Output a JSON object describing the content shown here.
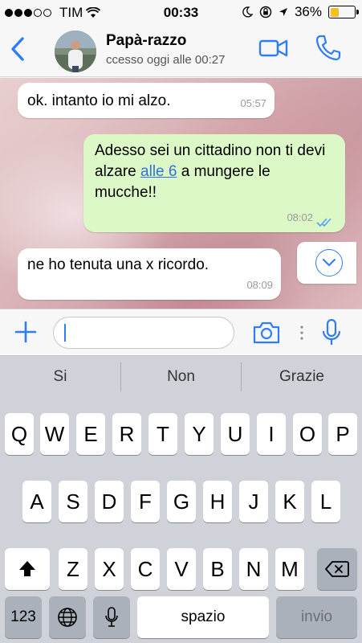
{
  "status_bar": {
    "carrier": "TIM",
    "time": "00:33",
    "battery_text": "36%",
    "battery_level": 0.36,
    "battery_color": "#f5c022"
  },
  "header": {
    "back_icon": "chevron-left-icon",
    "contact_name": "Papà-razzo",
    "contact_status": "ccesso oggi alle 00:27",
    "video_icon": "video-camera-icon",
    "call_icon": "phone-icon",
    "accent": "#2f7df6"
  },
  "chat": {
    "messages": [
      {
        "direction": "incoming",
        "text": "ok. intanto io mi alzo.",
        "time": "05:57"
      },
      {
        "direction": "outgoing",
        "text_before": "Adesso sei un cittadino non ti devi alzare ",
        "link_text": "alle 6",
        "text_after": " a mungere le mucche!!",
        "time": "08:02",
        "status": "read"
      },
      {
        "direction": "incoming",
        "text": "ne ho tenuta una x ricordo.",
        "time": "08:09"
      }
    ],
    "scroll_down_icon": "chevron-down-circle-icon"
  },
  "input_bar": {
    "plus_icon": "plus-icon",
    "message_value": "",
    "camera_icon": "camera-icon",
    "mic_icon": "microphone-icon"
  },
  "keyboard": {
    "predictions": [
      "Si",
      "Non",
      "Grazie"
    ],
    "row1": [
      "Q",
      "W",
      "E",
      "R",
      "T",
      "Y",
      "U",
      "I",
      "O",
      "P"
    ],
    "row2": [
      "A",
      "S",
      "D",
      "F",
      "G",
      "H",
      "J",
      "K",
      "L"
    ],
    "row3": [
      "Z",
      "X",
      "C",
      "V",
      "B",
      "N",
      "M"
    ],
    "numbers_key": "123",
    "space_key": "spazio",
    "return_key": "invio",
    "shift_icon": "shift-icon",
    "delete_icon": "backspace-icon",
    "globe_icon": "globe-icon",
    "dictation_icon": "microphone-icon"
  }
}
